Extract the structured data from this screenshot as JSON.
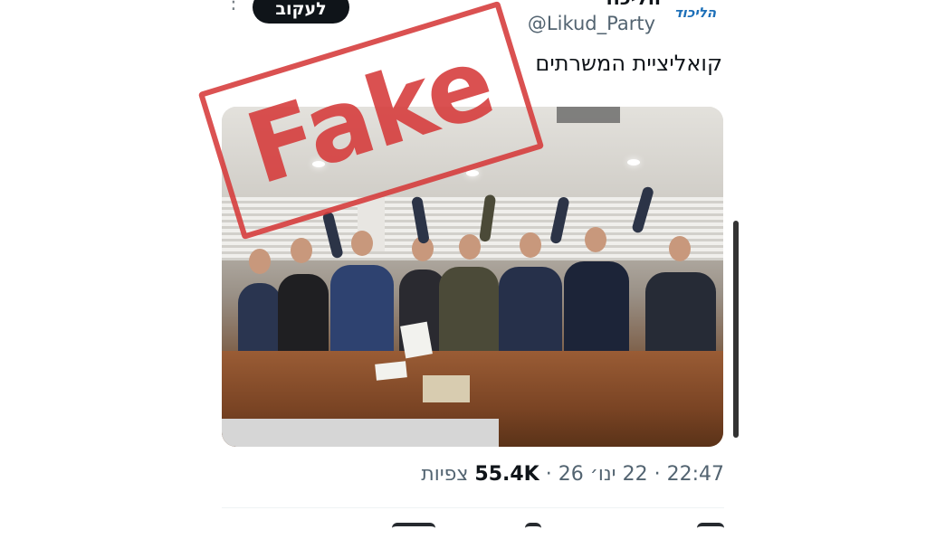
{
  "header": {
    "follow_label": "לעקוב",
    "author_name": "הליכוד",
    "handle": "@Likud_Party",
    "logo_text": "הליכוד"
  },
  "tweet": {
    "text": "קואליציית המשרתים",
    "stamp_text": "Fake"
  },
  "meta": {
    "time": "22:47",
    "date": "22 ינו׳ 26",
    "views_count": "55.4K",
    "views_label": "צפיות"
  },
  "colors": {
    "follow_bg": "#0f1419",
    "stamp_red": "#d63a3a",
    "handle_gray": "#536471",
    "logo_blue": "#1c6fb8"
  }
}
